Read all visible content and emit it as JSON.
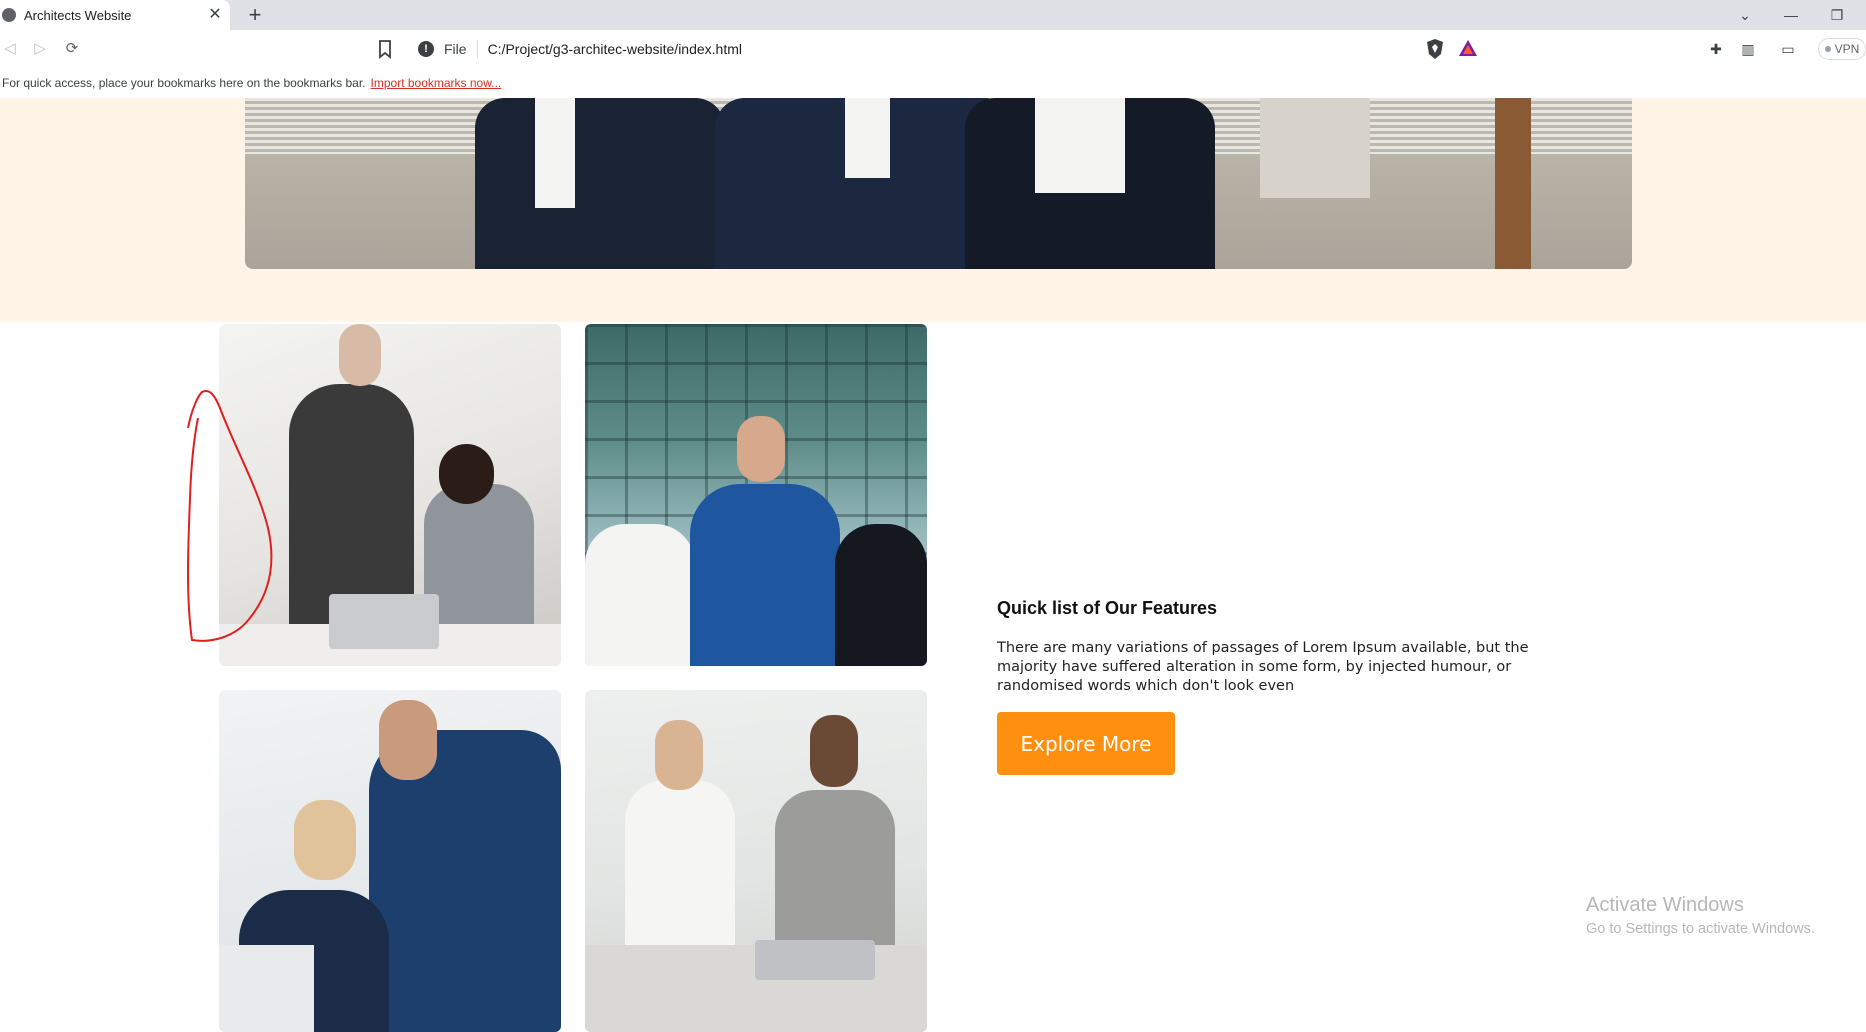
{
  "browser": {
    "tab_title": "Architects Website",
    "address_scheme": "File",
    "address_url": "C:/Project/g3-architec-website/index.html",
    "vpn_label": "VPN"
  },
  "bookmarks_bar": {
    "message": "For quick access, place your bookmarks here on the bookmarks bar.",
    "import_link": "Import bookmarks now..."
  },
  "features": {
    "title": "Quick list of Our Features",
    "text": "There are many variations of passages of Lorem Ipsum available, but the majority have suffered alteration in some form, by injected humour, or randomised words which don't look even",
    "button_label": "Explore More"
  },
  "windows_watermark": {
    "line1": "Activate Windows",
    "line2": "Go to Settings to activate Windows."
  },
  "colors": {
    "cream_band": "#fff4e6",
    "button": "#ff8f0f",
    "annotation": "#e02020"
  }
}
